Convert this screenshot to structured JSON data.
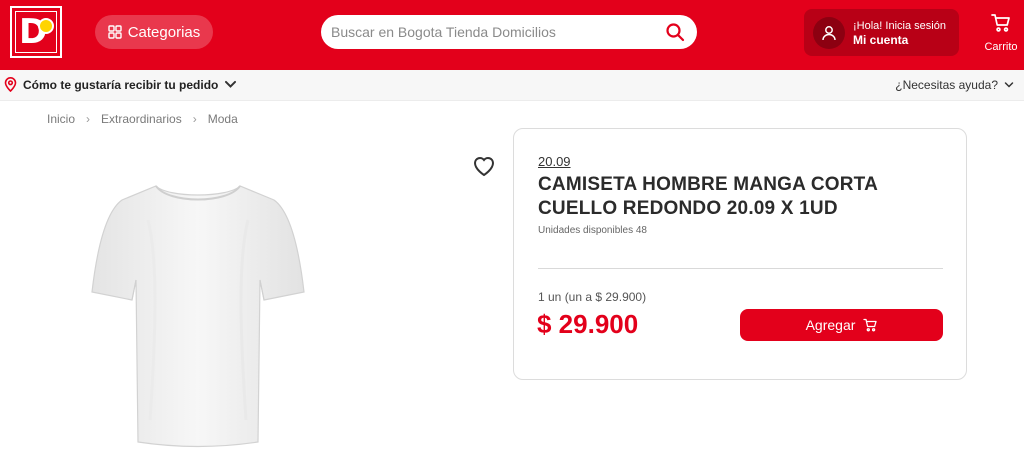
{
  "header": {
    "logo_text": "D1",
    "categories_label": "Categorias",
    "search_placeholder": "Buscar en Bogota Tienda Domicilios",
    "account_greeting": "¡Hola! Inicia sesión",
    "account_label": "Mi cuenta",
    "cart_label": "Carrito",
    "brand_color": "#e3001b"
  },
  "subbar": {
    "delivery_label": "Cómo te gustaría recibir tu pedido",
    "help_label": "¿Necesitas ayuda?"
  },
  "breadcrumb": [
    "Inicio",
    "Extraordinarios",
    "Moda"
  ],
  "product": {
    "brand": "20.09",
    "title": "CAMISETA HOMBRE MANGA CORTA CUELLO REDONDO 20.09 X 1UD",
    "stock": "Unidades disponibles 48",
    "unit_price": "1 un (un a $ 29.900)",
    "price": "$ 29.900",
    "add_label": "Agregar",
    "image_icon": "white-tshirt-image"
  }
}
